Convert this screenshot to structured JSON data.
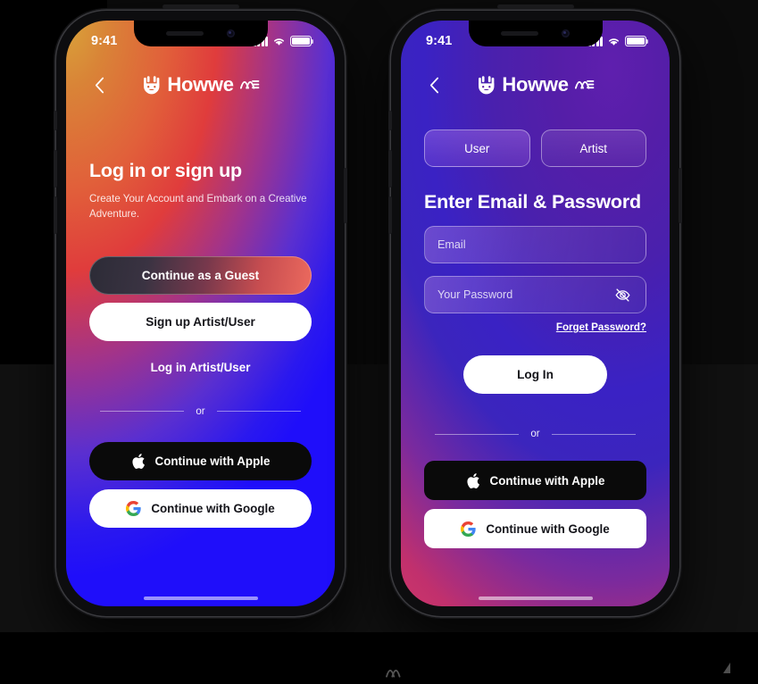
{
  "meta": {
    "scene": "Two iPhone mockups showing Howwe app authentication screens"
  },
  "brand": {
    "name": "Howwe",
    "mark_icon": "rock-on-hand-icon",
    "wave_icon": "sound-wave-icon"
  },
  "status_bar": {
    "time": "9:41",
    "signal_icon": "cellular-bars-icon",
    "wifi_icon": "wifi-icon",
    "battery_icon": "battery-full-icon"
  },
  "left_phone": {
    "back_icon": "chevron-left-icon",
    "heading": "Log in or sign up",
    "subtitle": "Create Your Account and Embark on a Creative Adventure.",
    "guest_button": "Continue as a Guest",
    "signup_button": "Sign up Artist/User",
    "login_link": "Log in Artist/User",
    "divider_label": "or",
    "apple_button": "Continue with Apple",
    "apple_icon": "apple-logo-icon",
    "google_button": "Continue with Google",
    "google_icon": "google-logo-icon"
  },
  "right_phone": {
    "back_icon": "chevron-left-icon",
    "tabs": [
      {
        "label": "User",
        "active": true
      },
      {
        "label": "Artist",
        "active": false
      }
    ],
    "heading": "Enter Email & Password",
    "email_field": {
      "placeholder": "Email",
      "value": ""
    },
    "password_field": {
      "placeholder": "Your Password",
      "value": "",
      "toggle_icon": "eye-off-icon"
    },
    "forgot_password": "Forget Password?",
    "login_button": "Log In",
    "divider_label": "or",
    "apple_button": "Continue with Apple",
    "apple_icon": "apple-logo-icon",
    "google_button": "Continue with Google",
    "google_icon": "google-logo-icon"
  },
  "colors": {
    "left_gradient_start": "#d9a43a",
    "left_gradient_mid": "#e03c3c",
    "left_gradient_end": "#1f0efa",
    "right_gradient_start": "#5f1fae",
    "right_gradient_mid": "#3a22c4",
    "right_gradient_end": "#d43a67",
    "white": "#ffffff",
    "black": "#0a0a0a",
    "canvas_background": "#000000"
  }
}
